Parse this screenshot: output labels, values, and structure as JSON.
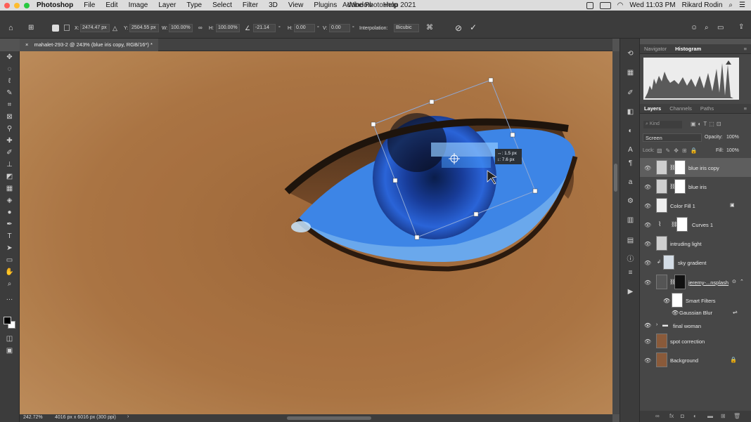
{
  "menubar": {
    "app": "Photoshop",
    "items": [
      "File",
      "Edit",
      "Image",
      "Layer",
      "Type",
      "Select",
      "Filter",
      "3D",
      "View",
      "Plugins",
      "Window",
      "Help"
    ],
    "window_title": "Adobe Photoshop 2021",
    "datetime": "Wed 11:03 PM",
    "user": "Rikard Rodin"
  },
  "options": {
    "x_label": "X:",
    "x_value": "2474.47 px",
    "y_label": "Y:",
    "y_value": "2504.55 px",
    "w_label": "W:",
    "w_value": "100.00%",
    "h_label": "H:",
    "h_value": "100.00%",
    "angle_value": "-21.14",
    "hskew_label": "H:",
    "hskew_value": "0.00",
    "vskew_label": "V:",
    "vskew_value": "0.00",
    "degree": "°",
    "interp_label": "Interpolation:",
    "interp_value": "Bicubic"
  },
  "document": {
    "tab_title": "mahalet-293-2 @ 243% (blue iris copy, RGB/16*) *",
    "zoom": "242.72%",
    "doc_info": "4016 px x 6016 px (300 ppi)",
    "tooltip_x": "↔: 1.5 px",
    "tooltip_y": "↕: 7.6 px"
  },
  "navigator_panel": {
    "tabs": [
      "Navigator",
      "Histogram"
    ],
    "active": "Histogram"
  },
  "layers_panel": {
    "tabs": [
      "Layers",
      "Channels",
      "Paths"
    ],
    "active": "Layers",
    "kind_placeholder": "Kind",
    "blend_mode": "Screen",
    "opacity_label": "Opacity:",
    "opacity_value": "100%",
    "lock_label": "Lock:",
    "fill_label": "Fill:",
    "fill_value": "100%",
    "layers": [
      {
        "name": "blue iris copy",
        "selected": true
      },
      {
        "name": "blue iris"
      },
      {
        "name": "Color Fill 1"
      },
      {
        "name": "Curves 1"
      },
      {
        "name": "intruding light"
      },
      {
        "name": "sky gradient"
      },
      {
        "name": "jeremy-...nsplash"
      },
      {
        "name": "Smart Filters"
      },
      {
        "name": "Gaussian Blur"
      },
      {
        "name": "final woman"
      },
      {
        "name": "spot correction"
      },
      {
        "name": "Background"
      }
    ]
  },
  "colors": {
    "iris": "#1c55c8",
    "skin": "#b27a47",
    "transform_handle": "#ffffff"
  }
}
